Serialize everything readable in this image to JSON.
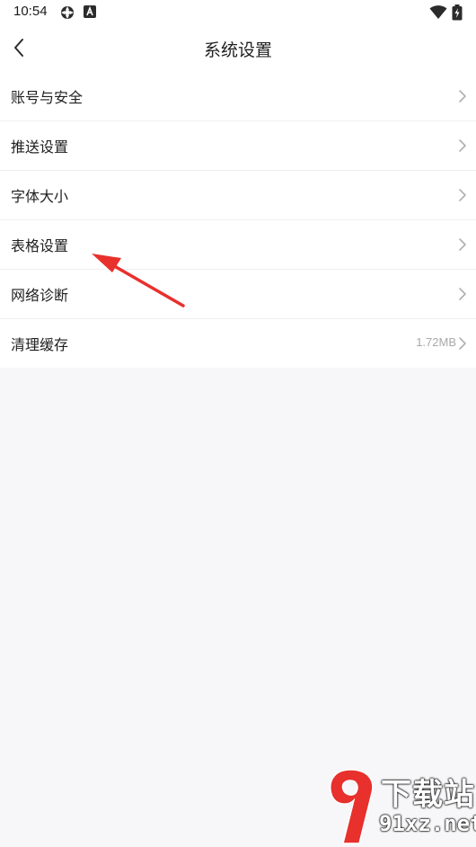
{
  "status_bar": {
    "time": "10:54",
    "icons": [
      "sync-icon",
      "font-a-icon",
      "wifi-icon",
      "battery-icon"
    ]
  },
  "header": {
    "title": "系统设置",
    "back_icon": "chevron-left-icon"
  },
  "settings": {
    "items": [
      {
        "label": "账号与安全",
        "value": ""
      },
      {
        "label": "推送设置",
        "value": ""
      },
      {
        "label": "字体大小",
        "value": ""
      },
      {
        "label": "表格设置",
        "value": ""
      },
      {
        "label": "网络诊断",
        "value": ""
      },
      {
        "label": "清理缓存",
        "value": "1.72MB"
      }
    ]
  },
  "annotation": {
    "color": "#e8302c",
    "target": "表格设置"
  },
  "watermark": {
    "title": "下载站",
    "url": "91xz.net",
    "colors": {
      "logo": "#e8302c",
      "text": "#ffffff"
    }
  }
}
